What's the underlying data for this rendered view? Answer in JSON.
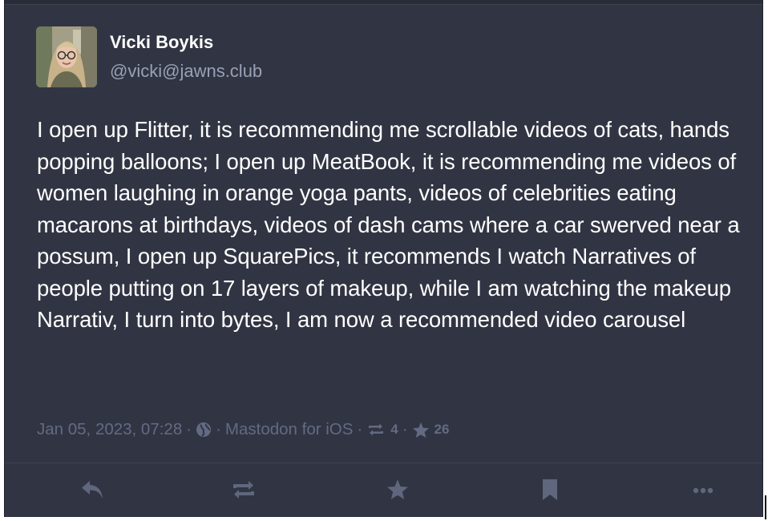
{
  "status": {
    "author": {
      "display_name": "Vicki Boykis",
      "account": "@vicki@jawns.club"
    },
    "content": "I open up Flitter, it is recommending me scrollable videos of cats, hands popping balloons; I open up MeatBook, it is recommending me videos of women laughing in orange yoga pants, videos of celebrities eating macarons at birthdays, videos of dash cams where a car swerved near a possum, I open up SquarePics, it recommends I watch Narratives of people putting on 17 layers of makeup, while I am watching the makeup Narrativ, I turn into bytes, I am now a recommended video carousel",
    "meta": {
      "timestamp": "Jan 05, 2023, 07:28",
      "separator": "·",
      "visibility_icon": "globe-icon",
      "application": "Mastodon for iOS",
      "boosts_count": "4",
      "favourites_count": "26"
    }
  },
  "actions": {
    "reply_icon": "reply-icon",
    "boost_icon": "boost-icon",
    "favourite_icon": "star-icon",
    "bookmark_icon": "bookmark-icon",
    "more_icon": "ellipsis-icon"
  },
  "colors": {
    "background": "#313543",
    "text": "#ffffff",
    "muted": "#636a82",
    "account": "#9aa0b5"
  }
}
